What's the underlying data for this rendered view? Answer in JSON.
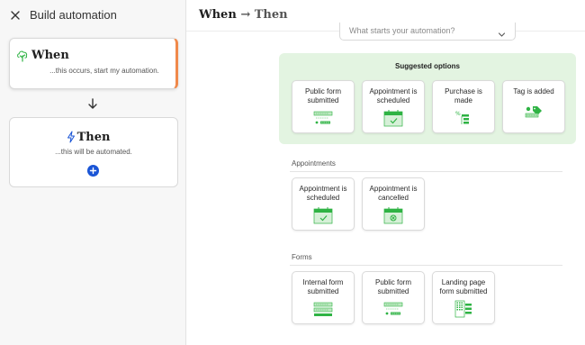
{
  "left_panel": {
    "title": "Build automation",
    "when": {
      "title": "When",
      "subtitle": "...this occurs, start my automation."
    },
    "then": {
      "title": "Then",
      "subtitle": "...this will be automated."
    }
  },
  "header": {
    "title_when": "When",
    "arrow": "→",
    "title_then": "Then"
  },
  "trigger_select": {
    "placeholder": "What starts your automation?"
  },
  "suggested": {
    "title": "Suggested options",
    "options": [
      {
        "label": "Public form submitted",
        "icon": "form-icon"
      },
      {
        "label": "Appointment is scheduled",
        "icon": "calendar-check-icon"
      },
      {
        "label": "Purchase is made",
        "icon": "receipt-icon"
      },
      {
        "label": "Tag is added",
        "icon": "tag-icon"
      }
    ]
  },
  "sections": [
    {
      "title": "Appointments",
      "options": [
        {
          "label": "Appointment is scheduled",
          "icon": "calendar-check-icon"
        },
        {
          "label": "Appointment is cancelled",
          "icon": "calendar-cancel-icon"
        }
      ]
    },
    {
      "title": "Forms",
      "options": [
        {
          "label": "Internal form submitted",
          "icon": "form-icon"
        },
        {
          "label": "Public form submitted",
          "icon": "form-icon"
        },
        {
          "label": "Landing page form submitted",
          "icon": "landing-page-icon"
        }
      ]
    }
  ],
  "colors": {
    "accent_green": "#2fb344",
    "suggested_bg": "#e3f4e1",
    "add_button": "#1a55d6",
    "when_border": "#f0894a"
  }
}
